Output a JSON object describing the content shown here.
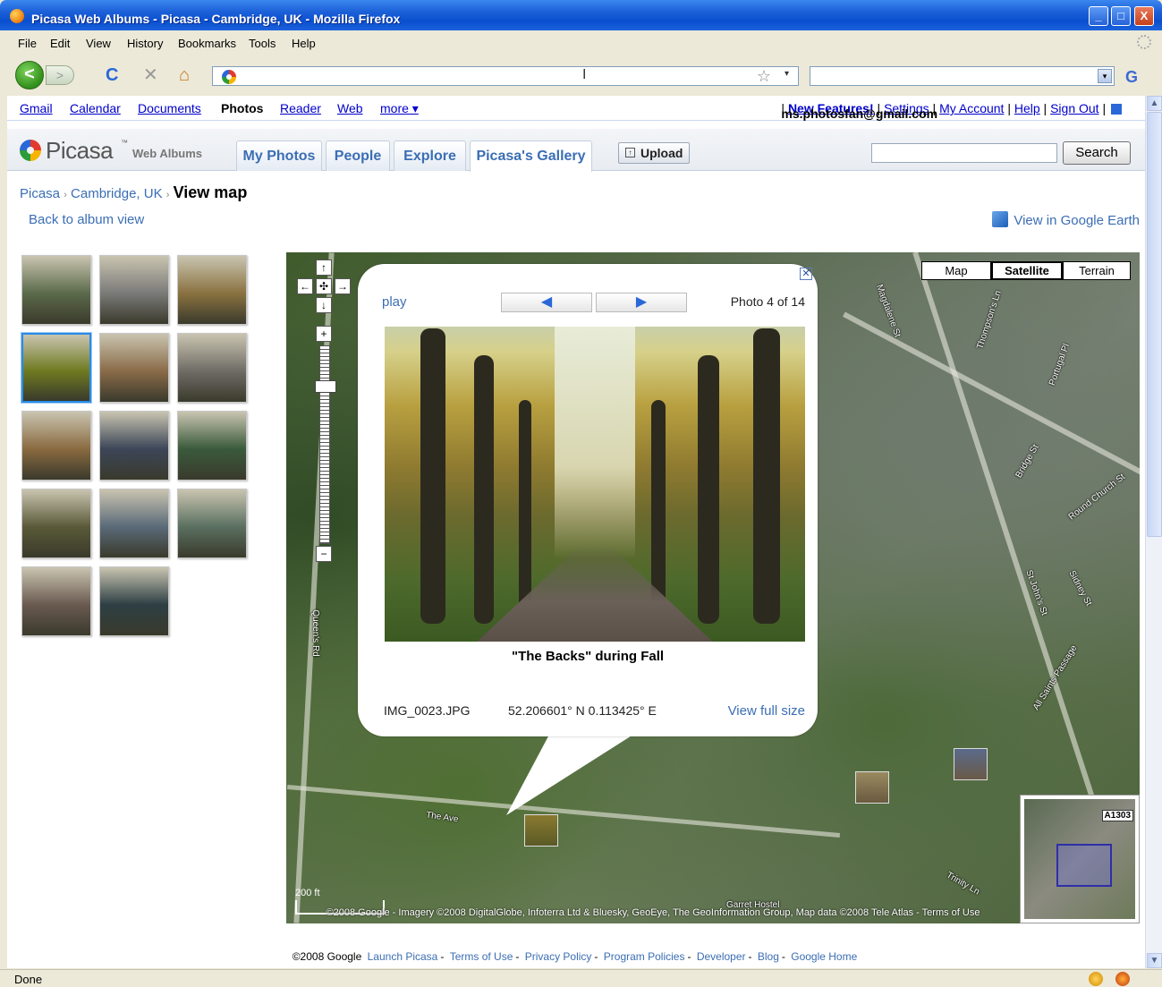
{
  "window": {
    "title": "Picasa Web Albums - Picasa - Cambridge, UK - Mozilla Firefox",
    "minimize": "_",
    "maximize": "□",
    "close": "X"
  },
  "menubar": {
    "items": [
      "File",
      "Edit",
      "View",
      "History",
      "Bookmarks",
      "Tools",
      "Help"
    ]
  },
  "toolbar": {
    "back": "<",
    "forward": ">",
    "reload": "C",
    "stop": "✕",
    "home": "⌂",
    "url": "",
    "search_value": ""
  },
  "gbar": {
    "links": [
      "Gmail",
      "Calendar",
      "Documents",
      "Photos",
      "Reader",
      "Web",
      "more ▾"
    ],
    "current": "Photos",
    "email": "ms.photosfan@gmail.com",
    "new_features": "New Features!",
    "settings": "Settings",
    "my_account": "My Account",
    "help": "Help",
    "sign_out": "Sign Out"
  },
  "picasa": {
    "brand": "Picasa",
    "tm": "™",
    "sub": "Web Albums",
    "tabs": [
      "My Photos",
      "People",
      "Explore",
      "Picasa's Gallery"
    ],
    "active_tab": "Picasa's Gallery",
    "upload": "Upload",
    "search_button": "Search",
    "search_value": ""
  },
  "breadcrumb": {
    "root": "Picasa",
    "album": "Cambridge, UK",
    "current": "View map",
    "sep": "›"
  },
  "links": {
    "back": "Back to album view",
    "google_earth": "View in Google Earth"
  },
  "thumbnails": {
    "count": 14,
    "selected_index": 3,
    "colors": [
      "#5b6a4a",
      "#7a7a78",
      "#8a7240",
      "#6e7a20",
      "#8a6b48",
      "#6f6c66",
      "#8a6a40",
      "#3c4658",
      "#3a5a3c",
      "#5a5a38",
      "#5a6a78",
      "#5a7060",
      "#6a5a50",
      "#2d3f44"
    ]
  },
  "map": {
    "types": [
      "Map",
      "Satellite",
      "Terrain"
    ],
    "active_type": "Satellite",
    "scale_label": "200 ft",
    "copyright": "©2008 Google - Imagery ©2008 DigitalGlobe, Infoterra Ltd & Bluesky, GeoEye, The GeoInformation Group, Map data ©2008 Tele Atlas - Terms of Use",
    "overview_tag": "A1303",
    "road_labels": [
      "Magdalene St",
      "Thompson's Ln",
      "Portugal Pl",
      "Bridge St",
      "Round Church St",
      "Sidney St",
      "St John's St",
      "All Saints Passage",
      "Trinity Ln",
      "The Ave",
      "Queen's Rd",
      "Garret Hostel"
    ]
  },
  "infowindow": {
    "play": "play",
    "prev": "◀",
    "next": "▶",
    "counter": "Photo 4 of 14",
    "caption": "\"The Backs\" during Fall",
    "filename": "IMG_0023.JPG",
    "coordinates": "52.206601° N  0.113425° E",
    "view_full": "View full size",
    "close": "✕"
  },
  "footer": {
    "copyright": "©2008 Google",
    "links": [
      "Launch Picasa",
      "Terms of Use",
      "Privacy Policy",
      "Program Policies",
      "Developer",
      "Blog",
      "Google Home"
    ]
  },
  "status": {
    "text": "Done"
  }
}
